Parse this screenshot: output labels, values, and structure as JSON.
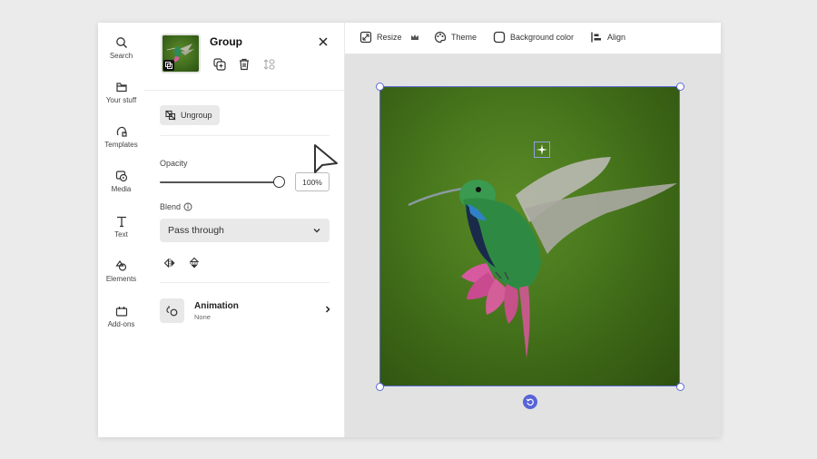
{
  "rail": {
    "items": [
      {
        "label": "Search",
        "icon": "search-icon"
      },
      {
        "label": "Your stuff",
        "icon": "folder-icon"
      },
      {
        "label": "Templates",
        "icon": "templates-icon"
      },
      {
        "label": "Media",
        "icon": "media-icon"
      },
      {
        "label": "Text",
        "icon": "text-icon"
      },
      {
        "label": "Elements",
        "icon": "elements-icon"
      },
      {
        "label": "Add-ons",
        "icon": "addons-icon"
      }
    ]
  },
  "panel": {
    "title": "Group",
    "ungroup_label": "Ungroup",
    "opacity_label": "Opacity",
    "opacity_value": "100%",
    "opacity_fraction": 1.0,
    "blend_label": "Blend",
    "blend_value": "Pass through",
    "animation_title": "Animation",
    "animation_value": "None"
  },
  "toolbar": {
    "resize_label": "Resize",
    "theme_label": "Theme",
    "background_label": "Background color",
    "align_label": "Align"
  },
  "colors": {
    "accent": "#5763d8",
    "selection": "#5c6bd6"
  }
}
